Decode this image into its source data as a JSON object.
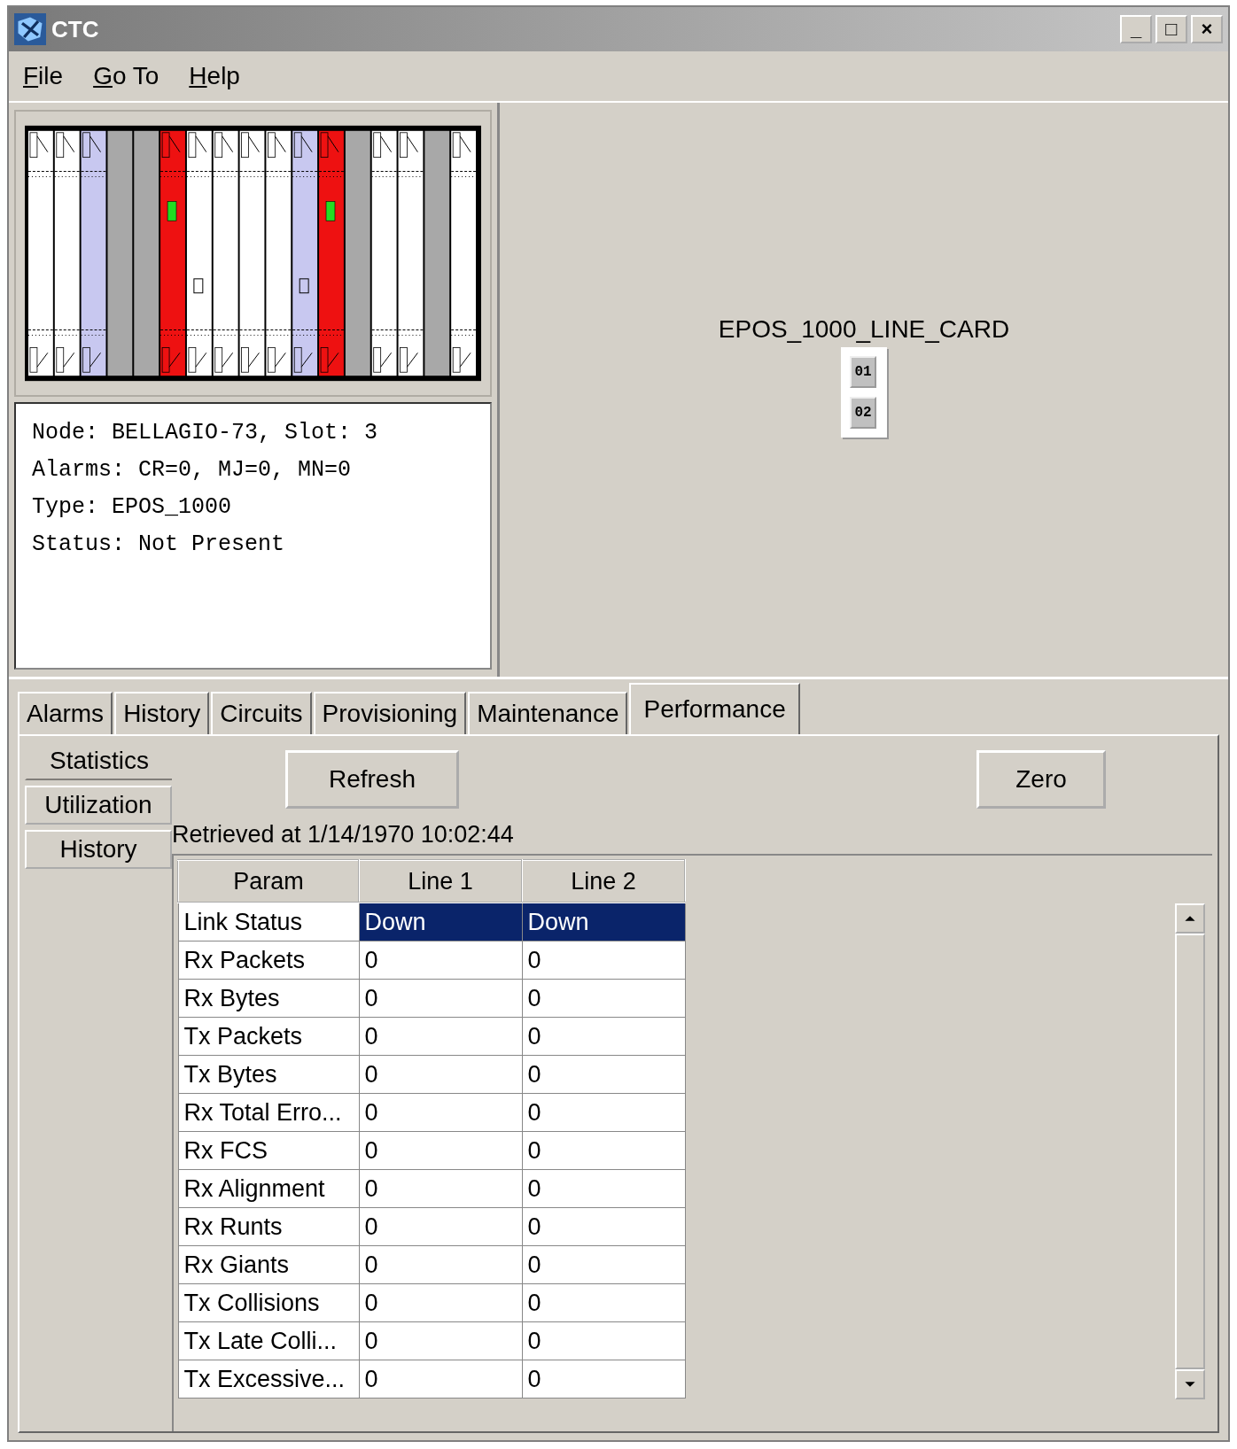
{
  "window": {
    "title": "CTC",
    "controls": [
      "_",
      "□",
      "×"
    ]
  },
  "menu": [
    {
      "label": "File"
    },
    {
      "label": "Go To"
    },
    {
      "label": "Help"
    }
  ],
  "shelf": {
    "slots": [
      {
        "kind": "card",
        "color": "#ffffff"
      },
      {
        "kind": "card",
        "color": "#ffffff"
      },
      {
        "kind": "card",
        "color": "#c8c8f0"
      },
      {
        "kind": "empty",
        "color": "#a8a8a8"
      },
      {
        "kind": "empty",
        "color": "#a8a8a8"
      },
      {
        "kind": "led",
        "color": "#ee1111"
      },
      {
        "kind": "timing",
        "color": "#ffffff"
      },
      {
        "kind": "card",
        "color": "#ffffff"
      },
      {
        "kind": "card",
        "color": "#ffffff"
      },
      {
        "kind": "card",
        "color": "#ffffff"
      },
      {
        "kind": "timing",
        "color": "#c8c8f0"
      },
      {
        "kind": "led",
        "color": "#ee1111"
      },
      {
        "kind": "empty",
        "color": "#a8a8a8"
      },
      {
        "kind": "card",
        "color": "#ffffff"
      },
      {
        "kind": "card",
        "color": "#ffffff"
      },
      {
        "kind": "empty",
        "color": "#a8a8a8"
      },
      {
        "kind": "card",
        "color": "#ffffff"
      }
    ]
  },
  "info": [
    "Node: BELLAGIO-73, Slot: 3",
    "Alarms: CR=0, MJ=0, MN=0",
    "Type: EPOS_1000",
    "Status: Not Present"
  ],
  "card_view": {
    "title": "EPOS_1000_LINE_CARD",
    "ports": [
      "01",
      "02"
    ]
  },
  "tabs": [
    {
      "label": "Alarms",
      "selected": false
    },
    {
      "label": "History",
      "selected": false
    },
    {
      "label": "Circuits",
      "selected": false
    },
    {
      "label": "Provisioning",
      "selected": false
    },
    {
      "label": "Maintenance",
      "selected": false
    },
    {
      "label": "Performance",
      "selected": true
    }
  ],
  "subtabs": [
    {
      "label": "Statistics",
      "selected": true
    },
    {
      "label": "Utilization",
      "selected": false
    },
    {
      "label": "History",
      "selected": false
    }
  ],
  "buttons": {
    "refresh": "Refresh",
    "zero": "Zero"
  },
  "retrieved": "Retrieved at 1/14/1970 10:02:44",
  "table": {
    "columns": [
      "Param",
      "Line 1",
      "Line 2"
    ],
    "rows": [
      {
        "cells": [
          "Link Status",
          "Down",
          "Down"
        ],
        "selected": true
      },
      {
        "cells": [
          "Rx Packets",
          "0",
          "0"
        ],
        "selected": false
      },
      {
        "cells": [
          "Rx Bytes",
          "0",
          "0"
        ],
        "selected": false
      },
      {
        "cells": [
          "Tx Packets",
          "0",
          "0"
        ],
        "selected": false
      },
      {
        "cells": [
          "Tx Bytes",
          "0",
          "0"
        ],
        "selected": false
      },
      {
        "cells": [
          "Rx Total Erro...",
          "0",
          "0"
        ],
        "selected": false
      },
      {
        "cells": [
          "Rx FCS",
          "0",
          "0"
        ],
        "selected": false
      },
      {
        "cells": [
          "Rx Alignment",
          "0",
          "0"
        ],
        "selected": false
      },
      {
        "cells": [
          "Rx Runts",
          "0",
          "0"
        ],
        "selected": false
      },
      {
        "cells": [
          "Rx Giants",
          "0",
          "0"
        ],
        "selected": false
      },
      {
        "cells": [
          "Tx Collisions",
          "0",
          "0"
        ],
        "selected": false
      },
      {
        "cells": [
          "Tx Late Colli...",
          "0",
          "0"
        ],
        "selected": false
      },
      {
        "cells": [
          "Tx Excessive...",
          "0",
          "0"
        ],
        "selected": false
      }
    ]
  }
}
